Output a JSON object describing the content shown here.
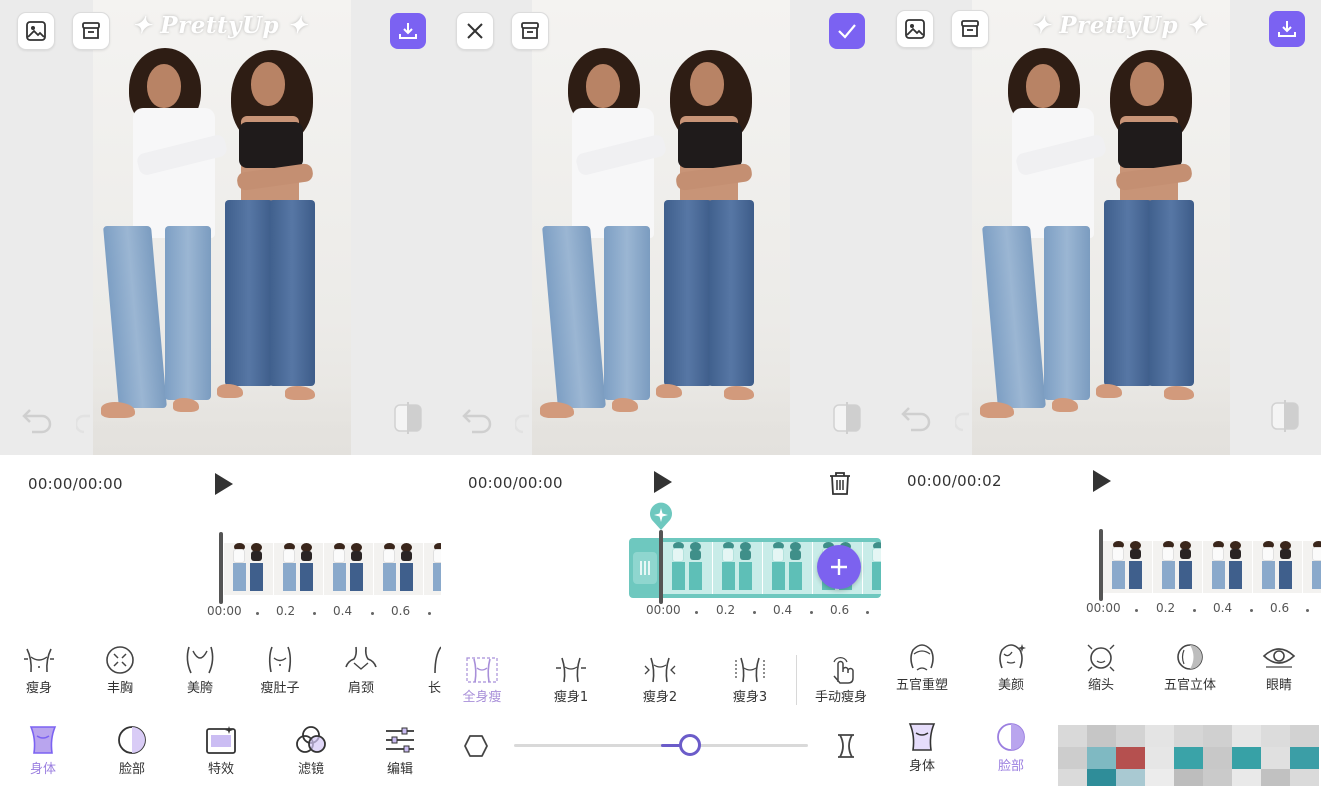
{
  "brand": {
    "logo_text": "✦ PrettyUp ✦",
    "accent_purple": "#7b62f2",
    "teal": "#6ec8bf"
  },
  "panels": [
    {
      "id": "body-editor",
      "top_bar": {
        "left_icons": [
          "gallery-icon",
          "archive-icon"
        ],
        "right_icon": "download-icon"
      },
      "overlay_icons": [
        "undo-icon",
        "redo-icon",
        "compare-icon"
      ],
      "time": "00:00/00:00",
      "ruler": [
        "00:00",
        "0.2",
        "0.4",
        "0.6"
      ],
      "tools": [
        {
          "label": "瘦身",
          "icon": "slim-body-icon"
        },
        {
          "label": "丰胸",
          "icon": "enlarge-chest-icon"
        },
        {
          "label": "美胯",
          "icon": "hips-icon"
        },
        {
          "label": "瘦肚子",
          "icon": "belly-icon"
        },
        {
          "label": "肩颈",
          "icon": "shoulder-neck-icon"
        },
        {
          "label": "长",
          "icon": "long-legs-icon"
        }
      ],
      "tabs": [
        {
          "label": "身体",
          "icon": "body-tab-icon",
          "active": true
        },
        {
          "label": "脸部",
          "icon": "face-tab-icon",
          "active": false
        },
        {
          "label": "特效",
          "icon": "effects-tab-icon",
          "active": false
        },
        {
          "label": "滤镜",
          "icon": "filter-tab-icon",
          "active": false
        },
        {
          "label": "编辑",
          "icon": "edit-tab-icon",
          "active": false
        }
      ]
    },
    {
      "id": "slim-adjust",
      "top_bar": {
        "left_icons": [
          "close-icon",
          "archive-icon"
        ],
        "right_icon": "confirm-check-icon"
      },
      "overlay_icons": [
        "undo-icon",
        "redo-icon",
        "compare-icon"
      ],
      "time": "00:00/00:00",
      "ruler": [
        "00:00",
        "0.2",
        "0.4",
        "0.6"
      ],
      "tools": [
        {
          "label": "全身瘦",
          "icon": "full-body-slim-icon",
          "active": true
        },
        {
          "label": "瘦身1",
          "icon": "slim-1-icon"
        },
        {
          "label": "瘦身2",
          "icon": "slim-2-icon"
        },
        {
          "label": "瘦身3",
          "icon": "slim-3-icon"
        },
        {
          "label": "手动瘦身",
          "icon": "manual-slim-icon"
        }
      ],
      "slider": {
        "value": 0.6,
        "min_icon": "hexagon-icon",
        "max_icon": "hourglass-icon"
      }
    },
    {
      "id": "face-editor",
      "top_bar": {
        "left_icons": [
          "gallery-icon",
          "archive-icon"
        ],
        "right_icon": "download-icon"
      },
      "overlay_icons": [
        "undo-icon",
        "redo-icon",
        "compare-icon"
      ],
      "time": "00:00/00:02",
      "ruler": [
        "00:00",
        "0.2",
        "0.4",
        "0.6"
      ],
      "tools": [
        {
          "label": "五官重塑",
          "icon": "reshape-features-icon"
        },
        {
          "label": "美颜",
          "icon": "beautify-icon"
        },
        {
          "label": "缩头",
          "icon": "shrink-head-icon"
        },
        {
          "label": "五官立体",
          "icon": "contour-icon"
        },
        {
          "label": "眼睛",
          "icon": "eye-icon"
        }
      ],
      "tabs": [
        {
          "label": "身体",
          "icon": "body-tab-icon",
          "active": false
        },
        {
          "label": "脸部",
          "icon": "face-tab-icon",
          "active": true
        }
      ]
    }
  ]
}
